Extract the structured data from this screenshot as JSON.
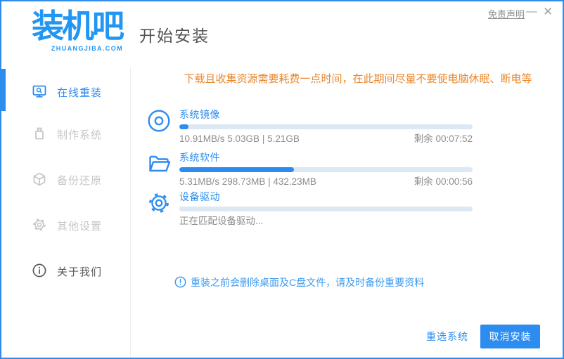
{
  "window": {
    "border_color": "#2f8ced"
  },
  "header": {
    "logo_title": "装机吧",
    "logo_subtitle": "ZHUANGJIBA.COM",
    "page_title": "开始安装",
    "disclaimer_link": "免责声明",
    "minimize_glyph": "—",
    "close_glyph": "✕"
  },
  "sidebar": {
    "items": [
      {
        "label": "在线重装",
        "icon": "monitor-search-icon",
        "state": "active"
      },
      {
        "label": "制作系统",
        "icon": "usb-drive-icon",
        "state": "muted"
      },
      {
        "label": "备份还原",
        "icon": "backup-box-icon",
        "state": "muted"
      },
      {
        "label": "其他设置",
        "icon": "gear-icon",
        "state": "muted"
      },
      {
        "label": "关于我们",
        "icon": "info-icon",
        "state": "normal"
      }
    ]
  },
  "main": {
    "warning_text": "下载且收集资源需要耗费一点时间，在此期间尽量不要使电脑休眠、断电等",
    "tasks": [
      {
        "name": "系统镜像",
        "icon": "disc-icon",
        "progress_percent": 3,
        "stats": "10.91MB/s 5.03GB | 5.21GB",
        "remaining": "剩余 00:07:52"
      },
      {
        "name": "系统软件",
        "icon": "folder-icon",
        "progress_percent": 39,
        "stats": "5.31MB/s 298.73MB | 432.23MB",
        "remaining": "剩余 00:00:56"
      },
      {
        "name": "设备驱动",
        "icon": "gear-icon",
        "progress_percent": 0,
        "stats": "正在匹配设备驱动...",
        "remaining": ""
      }
    ],
    "note_text": "重装之前会删除桌面及C盘文件，请及时备份重要资料"
  },
  "footer": {
    "reselect_button": "重选系统",
    "cancel_button": "取消安装"
  },
  "colors": {
    "accent_blue": "#2d8cf0",
    "logo_blue": "#2196f3",
    "warning_orange": "#e8872b",
    "note_blue": "#3d9bf0",
    "progress_track": "#dce8f4",
    "muted_gray": "#c6c6c6",
    "stats_gray": "#8c8c8c",
    "title_gray": "#525252"
  }
}
